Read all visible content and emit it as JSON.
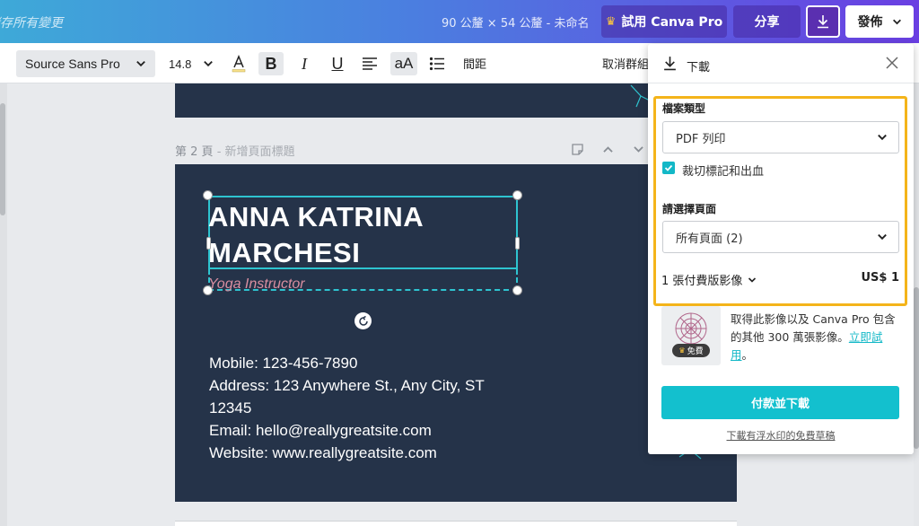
{
  "topbar": {
    "saved_status": "儲存所有變更",
    "doc_meta": "90 公釐 × 54 公釐 - 未命名",
    "try_pro_label": "試用 Canva Pro",
    "share_label": "分享",
    "publish_label": "發佈"
  },
  "toolbar": {
    "font_family": "Source Sans Pro",
    "font_size": "14.8",
    "bold_label": "B",
    "italic_label": "I",
    "underline_label": "U",
    "case_label": "aA",
    "spacing_label": "間距",
    "ungroup_label": "取消群組"
  },
  "canvas": {
    "page2_label": "第 2 頁",
    "page2_title_placeholder": "新增頁面標題",
    "name_line1": "ANNA KATRINA",
    "name_line2": "MARCHESI",
    "role": "Yoga Instructor",
    "contact_mobile": "Mobile: 123-456-7890",
    "contact_address": "Address: 123 Anywhere St., Any City, ST 12345",
    "contact_email": "Email: hello@reallygreatsite.com",
    "contact_website": "Website: www.reallygreatsite.com"
  },
  "download_panel": {
    "title": "下載",
    "file_type_label": "檔案類型",
    "file_type_value": "PDF 列印",
    "crop_marks_label": "裁切標記和出血",
    "crop_marks_checked": true,
    "pages_label": "請選擇頁面",
    "pages_value": "所有頁面 (2)",
    "paid_images_label": "1 張付費版影像",
    "price": "US$ 1",
    "thumb_badge": "免費",
    "promo_text": "取得此影像以及 Canva Pro 包含的其他 300 萬張影像。",
    "promo_link": "立即試用",
    "promo_tail": "。",
    "pay_button": "付款並下載",
    "free_link": "下載有浮水印的免費草稿"
  },
  "colors": {
    "accent": "#13c0ce",
    "highlight": "#f4b41a",
    "card_bg": "#253349",
    "role_pink": "#d88ea0"
  }
}
